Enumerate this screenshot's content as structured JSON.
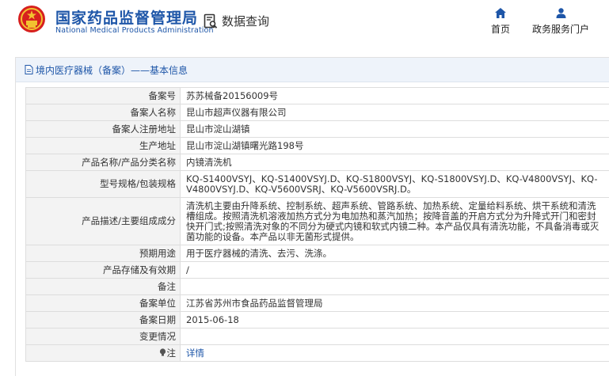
{
  "header": {
    "org_name": "国家药品监督管理局",
    "org_name_en": "National Medical Products Administration",
    "data_query": "数据查询",
    "nav": {
      "home": "首页",
      "gov": "政务服务门户"
    }
  },
  "panel": {
    "title": "境内医疗器械（备案）——基本信息"
  },
  "rows": [
    {
      "label": "备案号",
      "value": "苏苏械备20156009号"
    },
    {
      "label": "备案人名称",
      "value": "昆山市超声仪器有限公司"
    },
    {
      "label": "备案人注册地址",
      "value": "昆山市淀山湖镇"
    },
    {
      "label": "生产地址",
      "value": "昆山市淀山湖镇曙光路198号"
    },
    {
      "label": "产品名称/产品分类名称",
      "value": "内镜清洗机"
    },
    {
      "label": "型号规格/包装规格",
      "value": "KQ-S1400VSYJ、KQ-S1400VSYJ.D、KQ-S1800VSYJ、KQ-S1800VSYJ.D、KQ-V4800VSYJ、KQ-V4800VSYJ.D、KQ-V5600VSRJ、KQ-V5600VSRJ.D。"
    },
    {
      "label": "产品描述/主要组成成分",
      "value": "清洗机主要由升降系统、控制系统、超声系统、管路系统、加热系统、定量给料系统、烘干系统和清洗槽组成。按照清洗机溶液加热方式分为电加热和蒸汽加热；按降音盖的开启方式分为升降式开门和密封快开门式;按照清洗对象的不同分为硬式内镜和软式内镜二种。本产品仅具有清洗功能，不具备消毒或灭菌功能的设备。本产品以非无菌形式提供。"
    },
    {
      "label": "预期用途",
      "value": "用于医疗器械的清洗、去污、洗涤。"
    },
    {
      "label": "产品存储及有效期",
      "value": "/"
    },
    {
      "label": "备注",
      "value": ""
    },
    {
      "label": "备案单位",
      "value": "江苏省苏州市食品药品监督管理局"
    },
    {
      "label": "备案日期",
      "value": "2015-06-18"
    },
    {
      "label": "变更情况",
      "value": ""
    },
    {
      "label": "注",
      "value": "详情"
    }
  ],
  "colors": {
    "brand_blue": "#1e56a8",
    "emblem_red": "#d7201e",
    "label_bg": "#f3f3f3",
    "head_bg": "#eef3fa"
  },
  "icons": {
    "query": "document-search-icon",
    "home": "home-icon",
    "gov": "user-icon",
    "title": "document-icon",
    "note": "lightbulb-icon"
  }
}
